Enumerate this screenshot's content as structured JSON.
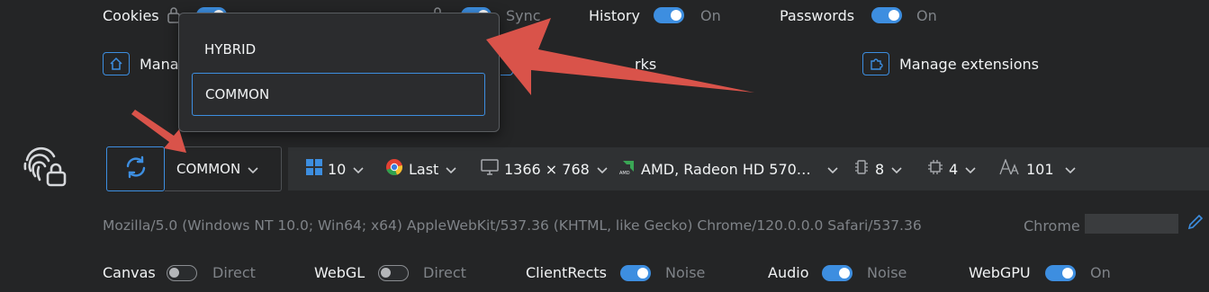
{
  "top_row": {
    "cookies_label": "Cookies",
    "storage_label": "Sync",
    "history": {
      "label": "History",
      "state": "On"
    },
    "passwords": {
      "label": "Passwords",
      "state": "On"
    }
  },
  "links": {
    "manage_prefix": "Mana",
    "bookmarks_fragment": "rks",
    "manage_extensions": "Manage extensions"
  },
  "profile_select": {
    "selected": "COMMON",
    "options": [
      "HYBRID",
      "COMMON"
    ]
  },
  "toolbar": {
    "os_version": "10",
    "browser_version": "Last",
    "resolution": "1366 × 768",
    "gpu": "AMD, Radeon HD 570…",
    "cpu_cores": "8",
    "memory": "4",
    "fonts_count": "101"
  },
  "user_agent": "Mozilla/5.0 (Windows NT 10.0; Win64; x64) AppleWebKit/537.36 (KHTML, like Gecko) Chrome/120.0.0.0 Safari/537.36",
  "browser_name": "Chrome",
  "bottom_row": {
    "canvas": {
      "label": "Canvas",
      "state": "Direct",
      "on": false
    },
    "webgl": {
      "label": "WebGL",
      "state": "Direct",
      "on": false
    },
    "clientrects": {
      "label": "ClientRects",
      "state": "Noise",
      "on": true
    },
    "audio": {
      "label": "Audio",
      "state": "Noise",
      "on": true
    },
    "webgpu": {
      "label": "WebGPU",
      "state": "On",
      "on": true
    }
  },
  "colors": {
    "accent": "#3d8ee0",
    "annotation_arrow": "#d9534a",
    "background": "#242526"
  }
}
